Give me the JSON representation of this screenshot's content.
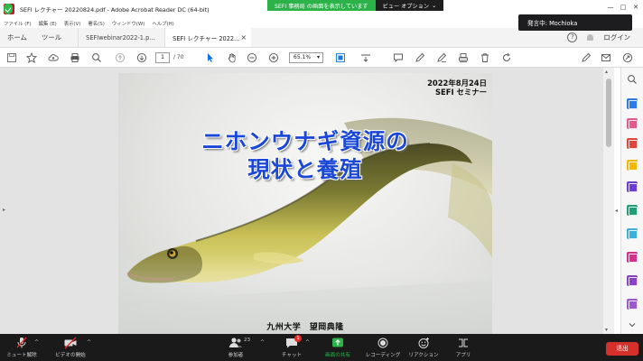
{
  "window": {
    "title": "SEFI レクチャー 20220824.pdf - Adobe Acrobat Reader DC (64-bit)",
    "controls": [
      "—",
      "□",
      "✕"
    ]
  },
  "share_banner": {
    "text": "SEFI 事務局 の画面を表示しています",
    "view_options": "ビュー オプション"
  },
  "speaker": {
    "text": "発言中: Mochioka"
  },
  "menubar": {
    "items": [
      "ファイル (F)",
      "編集 (E)",
      "表示(V)",
      "署名(S)",
      "ウィンドウ(W)",
      "ヘルプ(H)"
    ]
  },
  "tabs": {
    "home": "ホーム",
    "tools": "ツール",
    "doc1": "SEFIwebinar2022-1.p...",
    "doc2": "SEFI レクチャー 2022...",
    "close": "×",
    "login": "ログイン",
    "help": "?"
  },
  "toolbar": {
    "page_current": "1",
    "page_total": "/ 70",
    "zoom": "65.1%"
  },
  "slide": {
    "date_line1": "2022年8月24日",
    "date_line2": "SEFI セミナー",
    "title_line1": "ニホンウナギ資源の",
    "title_line2": "現状と養殖",
    "author": "九州大学　望岡典隆"
  },
  "zoombar": {
    "mute": "ミュート解除",
    "video": "ビデオの開始",
    "participants": "参加者",
    "participant_count": "23",
    "chat": "チャット",
    "chat_badge": "1",
    "share": "画面の共有",
    "record": "レコーディング",
    "reactions": "リアクション",
    "apps": "アプリ",
    "leave": "退出"
  },
  "colors": {
    "zoom_green": "#2bb34a",
    "slide_title_blue": "#1a47d8",
    "leave_red": "#d6302a",
    "toolbar_selected": "#1473e6"
  }
}
